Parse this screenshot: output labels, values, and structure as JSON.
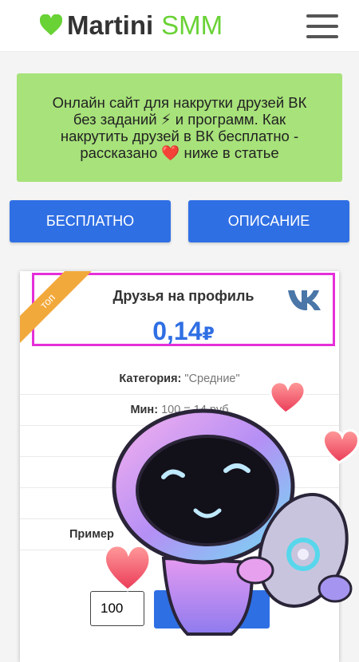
{
  "header": {
    "brand_dark": "Martini",
    "brand_green": "SMM",
    "menu_icon": "hamburger-menu-icon"
  },
  "promo": {
    "text": "Онлайн сайт для накрутки друзей ВК без заданий ⚡ и программ. Как накрутить друзей в ВК бесплатно - рассказано ❤️ ниже в статье"
  },
  "buttons": {
    "free": "БЕСПЛАТНО",
    "description": "ОПИСАНИЕ"
  },
  "card": {
    "ribbon": "топ",
    "title": "Друзья на профиль",
    "price": "0,14",
    "currency": "₽",
    "category_label": "Категория:",
    "category_value": "\"Средние\"",
    "min_label": "Мин:",
    "min_value": "100 = 14 руб",
    "example_label": "Пример",
    "quantity_value": "100"
  },
  "colors": {
    "accent_green": "#69d235",
    "promo_bg": "#a7e27a",
    "button_blue": "#2f6fe4",
    "highlight_border": "#e52fd9",
    "ribbon": "#f2a93b"
  }
}
